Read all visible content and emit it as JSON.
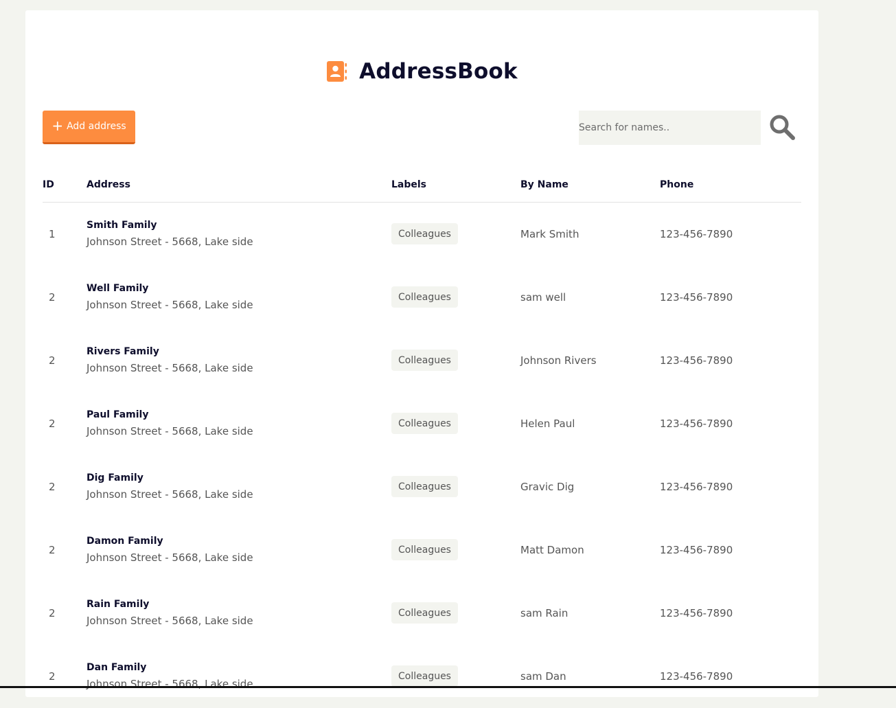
{
  "brand": {
    "title": "AddressBook",
    "icon": "address-book-icon",
    "accent_color": "#fd8c3f"
  },
  "toolbar": {
    "add_label": "Add address",
    "add_icon": "plus-icon",
    "search_placeholder": "Search for names..",
    "search_icon": "search-icon"
  },
  "table": {
    "headers": {
      "id": "ID",
      "address": "Address",
      "labels": "Labels",
      "by_name": "By Name",
      "phone": "Phone"
    },
    "rows": [
      {
        "id": "1",
        "family": "Smith Family",
        "street": "Johnson Street - 5668, Lake side",
        "label": "Colleagues",
        "name": "Mark Smith",
        "phone": "123-456-7890"
      },
      {
        "id": "2",
        "family": "Well Family",
        "street": "Johnson Street - 5668, Lake side",
        "label": "Colleagues",
        "name": "sam well",
        "phone": "123-456-7890"
      },
      {
        "id": "2",
        "family": "Rivers Family",
        "street": "Johnson Street - 5668, Lake side",
        "label": "Colleagues",
        "name": "Johnson Rivers",
        "phone": "123-456-7890"
      },
      {
        "id": "2",
        "family": "Paul Family",
        "street": "Johnson Street - 5668, Lake side",
        "label": "Colleagues",
        "name": "Helen Paul",
        "phone": "123-456-7890"
      },
      {
        "id": "2",
        "family": "Dig Family",
        "street": "Johnson Street - 5668, Lake side",
        "label": "Colleagues",
        "name": "Gravic Dig",
        "phone": "123-456-7890"
      },
      {
        "id": "2",
        "family": "Damon Family",
        "street": "Johnson Street - 5668, Lake side",
        "label": "Colleagues",
        "name": "Matt Damon",
        "phone": "123-456-7890"
      },
      {
        "id": "2",
        "family": "Rain Family",
        "street": "Johnson Street - 5668, Lake side",
        "label": "Colleagues",
        "name": "sam Rain",
        "phone": "123-456-7890"
      },
      {
        "id": "2",
        "family": "Dan Family",
        "street": "Johnson Street - 5668, Lake side",
        "label": "Colleagues",
        "name": "sam Dan",
        "phone": "123-456-7890"
      }
    ]
  }
}
